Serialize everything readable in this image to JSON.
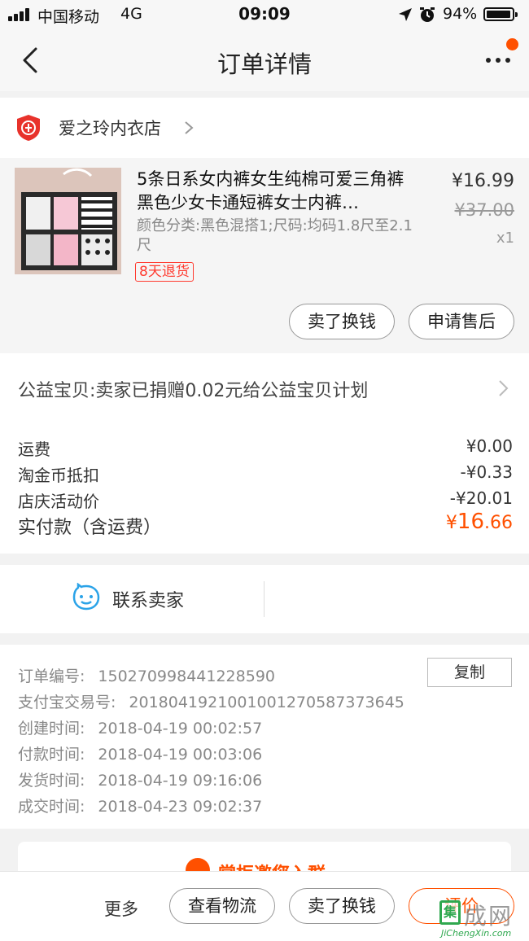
{
  "status_bar": {
    "carrier": "中国移动",
    "network": "4G",
    "time": "09:09",
    "battery_pct": "94%"
  },
  "nav": {
    "title": "订单详情",
    "more_icon": "more-dots-icon",
    "back_icon": "back-chevron-icon"
  },
  "shop": {
    "name": "爱之玲内衣店",
    "logo_icon": "enterprise-shop-icon"
  },
  "item": {
    "title": "5条日系女内裤女生纯棉可爱三角裤黑色少女卡通短裤女士内裤…",
    "spec": "颜色分类:黑色混搭1;尺码:均码1.8尺至2.1尺",
    "tag": "8天退货",
    "price": "¥16.99",
    "original_price": "¥37.00",
    "quantity": "x1",
    "btn_sell": "卖了换钱",
    "btn_aftersale": "申请售后"
  },
  "charity": {
    "text": "公益宝贝:卖家已捐赠0.02元给公益宝贝计划"
  },
  "fees": [
    {
      "label": "运费",
      "value": "¥0.00"
    },
    {
      "label": "淘金币抵扣",
      "value": "-¥0.33"
    },
    {
      "label": "店庆活动价",
      "value": "-¥20.01"
    }
  ],
  "total": {
    "label": "实付款（含运费）",
    "currency": "¥",
    "integer": "16",
    "decimal": ".66"
  },
  "contact": {
    "label": "联系卖家",
    "icon": "chat-bubble-icon"
  },
  "order_info": {
    "copy_label": "复制",
    "rows": [
      {
        "label": "订单编号:",
        "value": "150270998441228590"
      },
      {
        "label": "支付宝交易号:",
        "value": "2018041921001001270587373645"
      },
      {
        "label": "创建时间:",
        "value": "2018-04-19 00:02:57"
      },
      {
        "label": "付款时间:",
        "value": "2018-04-19 00:03:06"
      },
      {
        "label": "发货时间:",
        "value": "2018-04-19 09:16:06"
      },
      {
        "label": "成交时间:",
        "value": "2018-04-23 09:02:37"
      }
    ]
  },
  "promo": {
    "text": "掌柜邀您入群"
  },
  "bottom_bar": {
    "more": "更多",
    "logistics": "查看物流",
    "sell": "卖了换钱",
    "evaluate": "评价"
  },
  "watermark": {
    "box_char": "集",
    "cn": "成网",
    "en": "JiChengXin.com"
  },
  "colors": {
    "accent": "#ff5000",
    "tag_red": "#ff3b30",
    "page_bg": "#f2f2f2"
  }
}
